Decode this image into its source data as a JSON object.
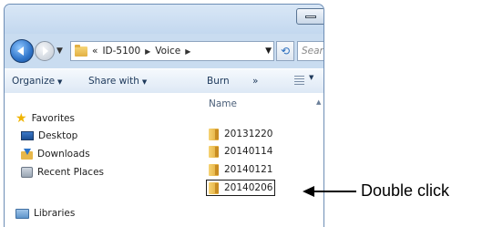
{
  "navigation": {
    "breadcrumb_prefix": "«",
    "path": [
      "ID-5100",
      "Voice"
    ],
    "search_placeholder": "Sear"
  },
  "toolbar": {
    "organize": "Organize",
    "share_with": "Share with",
    "burn": "Burn",
    "overflow": "»"
  },
  "nav_pane": {
    "favorites": "Favorites",
    "items": [
      "Desktop",
      "Downloads",
      "Recent Places"
    ],
    "libraries": "Libraries"
  },
  "file_list": {
    "column_name": "Name",
    "folders": [
      "20131220",
      "20140114",
      "20140121",
      "20140206"
    ],
    "selected": "20140206"
  },
  "annotation": {
    "label": "Double click"
  },
  "icons": {
    "back": "back-arrow-icon",
    "forward": "forward-arrow-icon",
    "refresh": "refresh-icon",
    "folder": "folder-icon",
    "star": "star-icon"
  },
  "colors": {
    "chrome": "#c9dcf0",
    "folder": "#e7b74a",
    "accent": "#2f74c9"
  }
}
